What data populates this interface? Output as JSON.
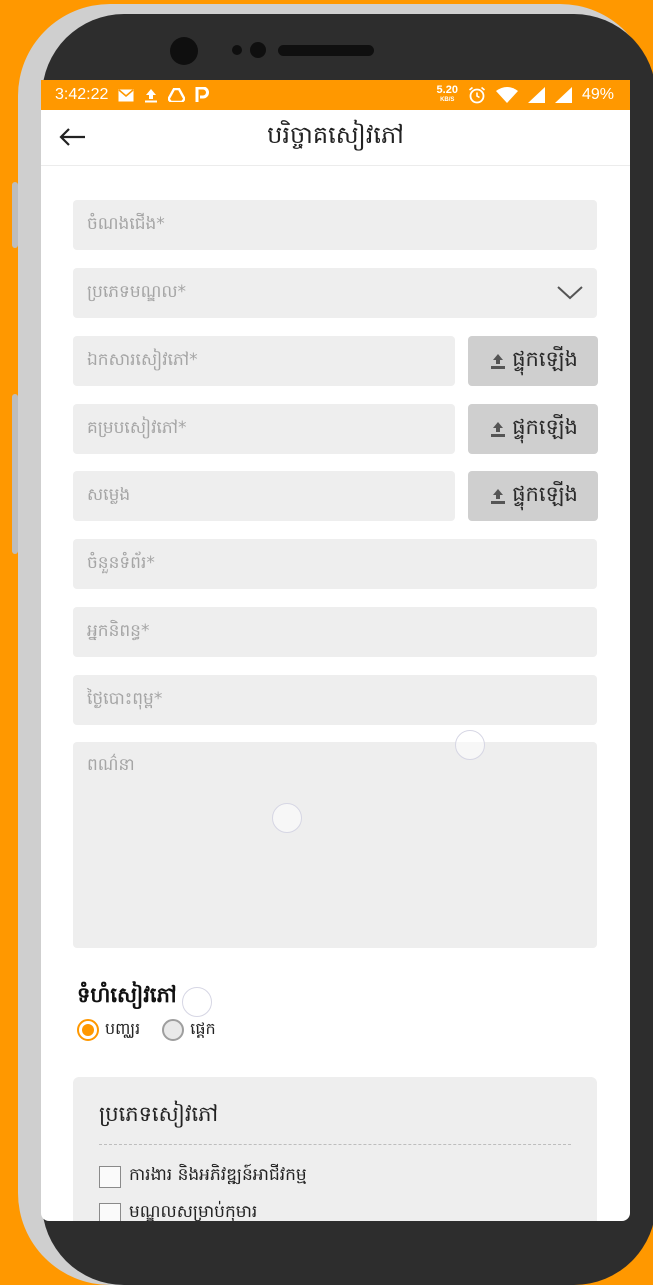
{
  "status_bar": {
    "time": "3:42:22",
    "net_speed_value": "5.20",
    "net_speed_unit": "KB/S",
    "battery": "49%"
  },
  "app_bar": {
    "title": "បរិច្ចាគសៀវភៅ"
  },
  "form": {
    "title_placeholder": "ចំណងជើង*",
    "category_placeholder": "ប្រភេទមណ្ឌល*",
    "book_file_placeholder": "ឯកសារសៀវភៅ*",
    "book_cover_placeholder": "គម្របសៀវភៅ*",
    "audio_placeholder": "សម្លេង",
    "page_count_placeholder": "ចំនួនទំព័រ*",
    "author_placeholder": "អ្នកនិពន្ធ*",
    "publish_date_placeholder": "ថ្ងៃបោះពុម្ព*",
    "description_placeholder": "ពណ៌នា",
    "upload_label": "ផ្ទុកឡើង"
  },
  "book_size": {
    "title": "ទំហំសៀវភៅ",
    "options": [
      "បញ្ឈរ",
      "ផ្តេក"
    ],
    "selected_index": 0
  },
  "book_type": {
    "title": "ប្រភេទសៀវភៅ",
    "items": [
      "ការងារ និងអភិវឌ្ឍន៍អាជីវកម្ម",
      "មណ្ឌលសម្រាប់កុមារ"
    ]
  },
  "colors": {
    "accent": "#FF9800",
    "field_bg": "#EEEEEE",
    "upload_bg": "#CFCFCF"
  }
}
